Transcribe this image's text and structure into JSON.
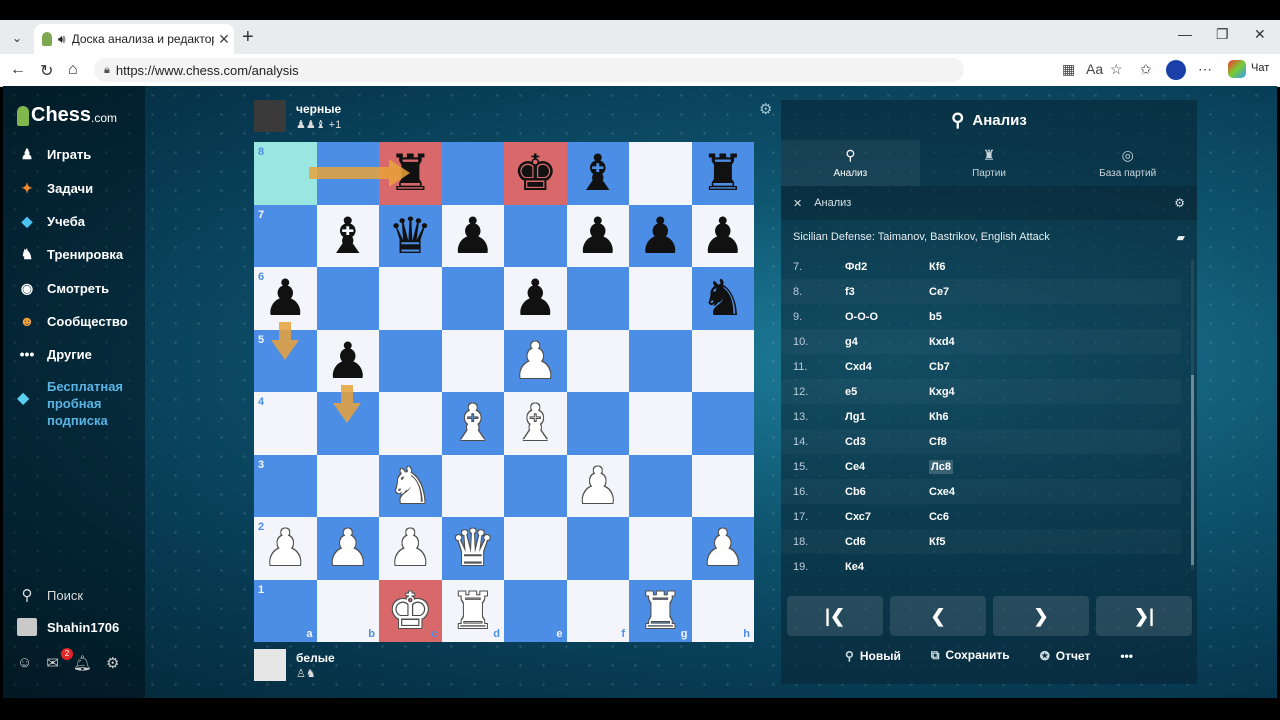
{
  "browser": {
    "tab_title": "Доска анализа и редактор P",
    "url": "https://www.chess.com/analysis",
    "chat_label": "Чат"
  },
  "sidebar": {
    "logo_text": "Chess",
    "logo_suffix": ".com",
    "items": [
      {
        "label": "Играть",
        "icon": "play-icon"
      },
      {
        "label": "Задачи",
        "icon": "puzzle-icon"
      },
      {
        "label": "Учеба",
        "icon": "learn-icon"
      },
      {
        "label": "Тренировка",
        "icon": "train-icon"
      },
      {
        "label": "Смотреть",
        "icon": "watch-icon"
      },
      {
        "label": "Сообщество",
        "icon": "community-icon"
      },
      {
        "label": "Другие",
        "icon": "more-icon"
      }
    ],
    "promo_line1": "Бесплатная",
    "promo_line2": "пробная",
    "promo_line3": "подписка",
    "search_label": "Поиск",
    "username": "Shahin1706",
    "notification_count": "2"
  },
  "players": {
    "top": {
      "name": "черные",
      "captured": "♟♟♝ +1"
    },
    "bottom": {
      "name": "белые",
      "captured": "♙♞"
    }
  },
  "board": {
    "ranks": [
      "8",
      "7",
      "6",
      "5",
      "4",
      "3",
      "2",
      "1"
    ],
    "files": [
      "a",
      "b",
      "c",
      "d",
      "e",
      "f",
      "g",
      "h"
    ],
    "rows": [
      [
        ".",
        ".",
        "r",
        ".",
        "k",
        "b",
        ".",
        "r"
      ],
      [
        ".",
        "b",
        "q",
        "p",
        ".",
        "p",
        "p",
        "p"
      ],
      [
        "p",
        ".",
        ".",
        ".",
        "p",
        ".",
        ".",
        "n"
      ],
      [
        ".",
        "p",
        ".",
        ".",
        "P",
        ".",
        ".",
        "."
      ],
      [
        ".",
        ".",
        ".",
        "B",
        "B",
        ".",
        ".",
        "."
      ],
      [
        ".",
        ".",
        "N",
        ".",
        ".",
        "P",
        ".",
        "."
      ],
      [
        "P",
        "P",
        "P",
        "Q",
        ".",
        ".",
        ".",
        "P"
      ],
      [
        ".",
        ".",
        "K",
        "R",
        ".",
        ".",
        "R",
        "."
      ]
    ],
    "highlight_squares": [
      "a8"
    ],
    "red_squares": [
      "c8",
      "e8",
      "c1"
    ]
  },
  "panel": {
    "title": "Анализ",
    "tabs": [
      {
        "label": "Анализ"
      },
      {
        "label": "Партии"
      },
      {
        "label": "База партий"
      }
    ],
    "subheader": "Анализ",
    "opening": "Sicilian Defense: Taimanov, Bastrikov, English Attack",
    "moves": [
      {
        "n": "7.",
        "w": "Фd2",
        "b": "Кf6"
      },
      {
        "n": "8.",
        "w": "f3",
        "b": "Се7"
      },
      {
        "n": "9.",
        "w": "O-O-O",
        "b": "b5"
      },
      {
        "n": "10.",
        "w": "g4",
        "b": "Кxd4"
      },
      {
        "n": "11.",
        "w": "Сxd4",
        "b": "Сb7"
      },
      {
        "n": "12.",
        "w": "e5",
        "b": "Кxg4"
      },
      {
        "n": "13.",
        "w": "Лg1",
        "b": "Кh6"
      },
      {
        "n": "14.",
        "w": "Сd3",
        "b": "Сf8"
      },
      {
        "n": "15.",
        "w": "Се4",
        "b": "Лс8"
      },
      {
        "n": "16.",
        "w": "Сb6",
        "b": "Схе4"
      },
      {
        "n": "17.",
        "w": "Схс7",
        "b": "Сс6"
      },
      {
        "n": "18.",
        "w": "Cd6",
        "b": "Кf5"
      },
      {
        "n": "19.",
        "w": "Ке4",
        "b": ""
      }
    ],
    "current_move_index": 8,
    "actions": {
      "new": "Новый",
      "save": "Сохранить",
      "report": "Отчет"
    }
  }
}
